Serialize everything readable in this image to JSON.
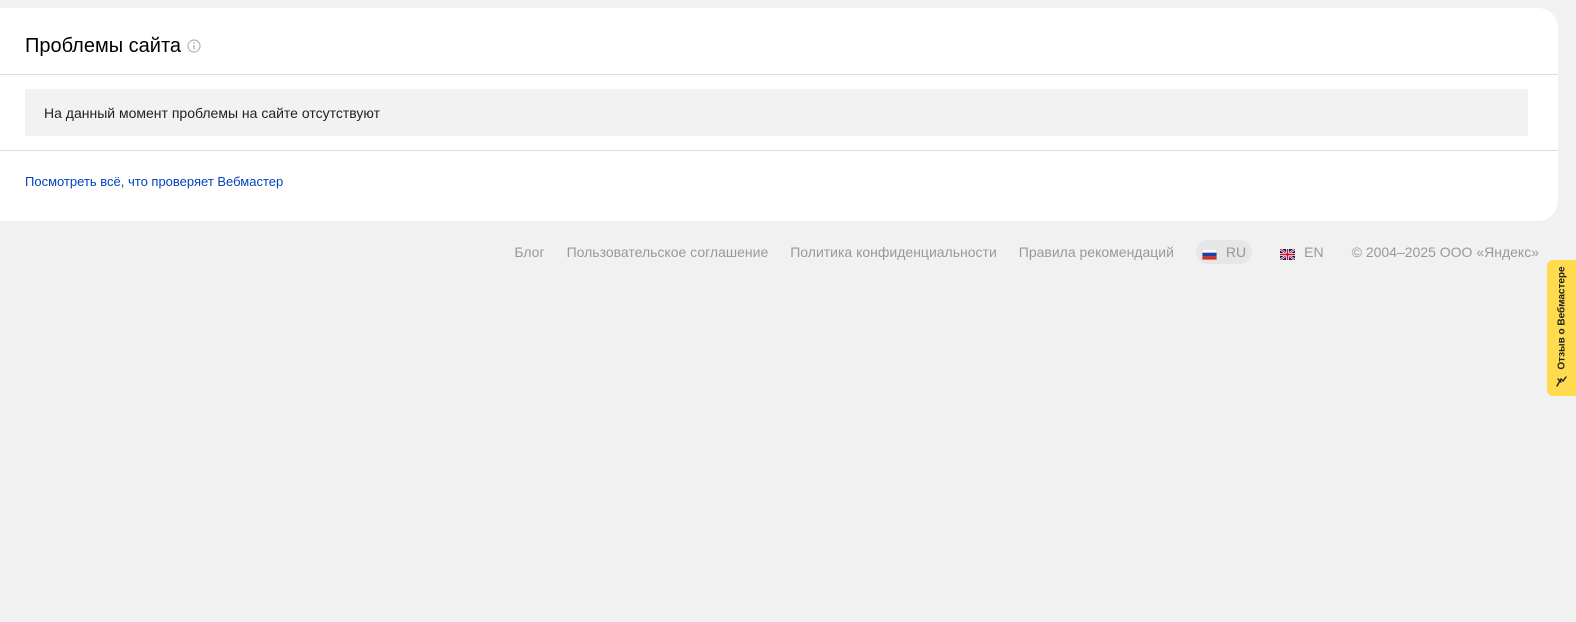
{
  "card": {
    "title": "Проблемы сайта",
    "notice": "На данный момент проблемы на сайте отсутствуют",
    "link": "Посмотреть всё, что проверяет Вебмастер"
  },
  "footer": {
    "links": [
      "Блог",
      "Пользовательское соглашение",
      "Политика конфиденциальности",
      "Правила рекомендаций"
    ],
    "lang_ru": "RU",
    "lang_en": "EN",
    "copyright": "© 2004–2025 ООО «Яндекс»"
  },
  "feedback": {
    "label": "Отзыв о Вебмастере"
  },
  "colors": {
    "link": "#0044bb",
    "feedback_bg": "#ffdb4d",
    "page_bg": "#f1f1f1"
  },
  "icons": {
    "title_info": "info-icon",
    "ru_flag": "russia-flag-icon",
    "en_flag": "uk-flag-icon",
    "feedback": "feedback-icon"
  }
}
